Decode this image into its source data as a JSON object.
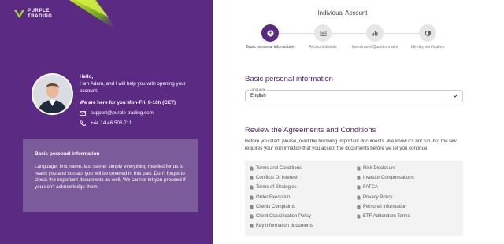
{
  "brand": {
    "line1": "PURPLE",
    "line2": "TRADING"
  },
  "intro": {
    "hello": "Hello,",
    "message": "I am Adam, and I will help you with opening your account.",
    "hours": "We are here for you Mon-Fri, 8-16h (CET)",
    "email": "support@purple-trading.com",
    "phone": "+44 14 46 506 711"
  },
  "info_box": {
    "title": "Basic personal information",
    "text": "Language, first name, last name, simply everything needed for us to reach you and contact you will be covered in this part. Don't forget to check the important documents as well. We cannot let you proceed if you don't acknowledge them."
  },
  "account_title": "Individual Account",
  "steps": [
    {
      "label": "Basic personal information",
      "icon": "user-icon",
      "active": true
    },
    {
      "label": "Account details",
      "icon": "document-icon",
      "active": false
    },
    {
      "label": "Investment Questionnaire",
      "icon": "bar-chart-icon",
      "active": false
    },
    {
      "label": "Identity verification",
      "icon": "shield-icon",
      "active": false
    }
  ],
  "basic_section_title": "Basic personal information",
  "language_field": {
    "label": "Language",
    "value": "English"
  },
  "agreements": {
    "title": "Review the Agreements and Conditions",
    "text": "Before you start, please, read the following important documents. We know it's not fun, but the law requires your confirmation that you accept the documents before we let you continue.",
    "left": [
      "Terms and Conditions",
      "Conflicts Of Interest",
      "Terms of Strategies",
      "Order Execution",
      "Clients Complaints",
      "Client Classification Policy",
      "Key Information documents"
    ],
    "right": [
      "Risk Disclosure",
      "Investor Compensations",
      "FATCA",
      "Privacy Policy",
      "Personal Information",
      "ETF Addendum Terms"
    ]
  },
  "colors": {
    "brand_purple": "#5b2a82",
    "accent_green": "#9fd62a",
    "box_purple": "#7c5b9a"
  }
}
